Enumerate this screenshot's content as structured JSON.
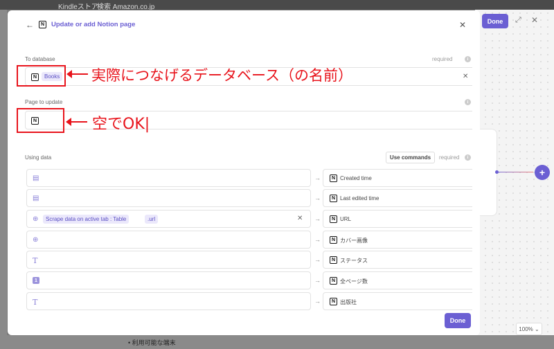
{
  "background": {
    "top_left": "Kindleストア",
    "top_middle": "検索 Amazon.co.jp",
    "bottom_text": "利用可能な端末"
  },
  "canvas": {
    "done_label": "Done",
    "expand_icon": "expand-icon",
    "close_icon": "close-icon",
    "add_icon": "plus-icon",
    "zoom": "100%"
  },
  "modal": {
    "title": "Update or add Notion page",
    "to_database": {
      "label": "To database",
      "required": "required",
      "value": "Books"
    },
    "page_to_update": {
      "label": "Page to update"
    },
    "using_data": {
      "label": "Using data",
      "use_commands": "Use commands",
      "required": "required",
      "rows": [
        {
          "source_icon": "calendar-icon",
          "property": "Created time"
        },
        {
          "source_icon": "calendar-icon",
          "property": "Last edited time"
        },
        {
          "source_icon": "globe-icon",
          "source_chip": "Scrape data on active tab : Table",
          "source_chip2": ".url",
          "property": "URL"
        },
        {
          "source_icon": "globe-icon",
          "property": "カバー画像"
        },
        {
          "source_icon": "text-icon",
          "property": "ステータス"
        },
        {
          "source_icon": "number-icon",
          "property": "全ページ数"
        },
        {
          "source_icon": "text-icon",
          "property": "出版社"
        }
      ]
    },
    "done_label": "Done"
  },
  "annotations": {
    "database_note": "実際につなげるデータベース（の名前）",
    "page_note": "空でOK"
  },
  "colors": {
    "accent": "#6b5fd3",
    "annotation": "#e8131b"
  }
}
